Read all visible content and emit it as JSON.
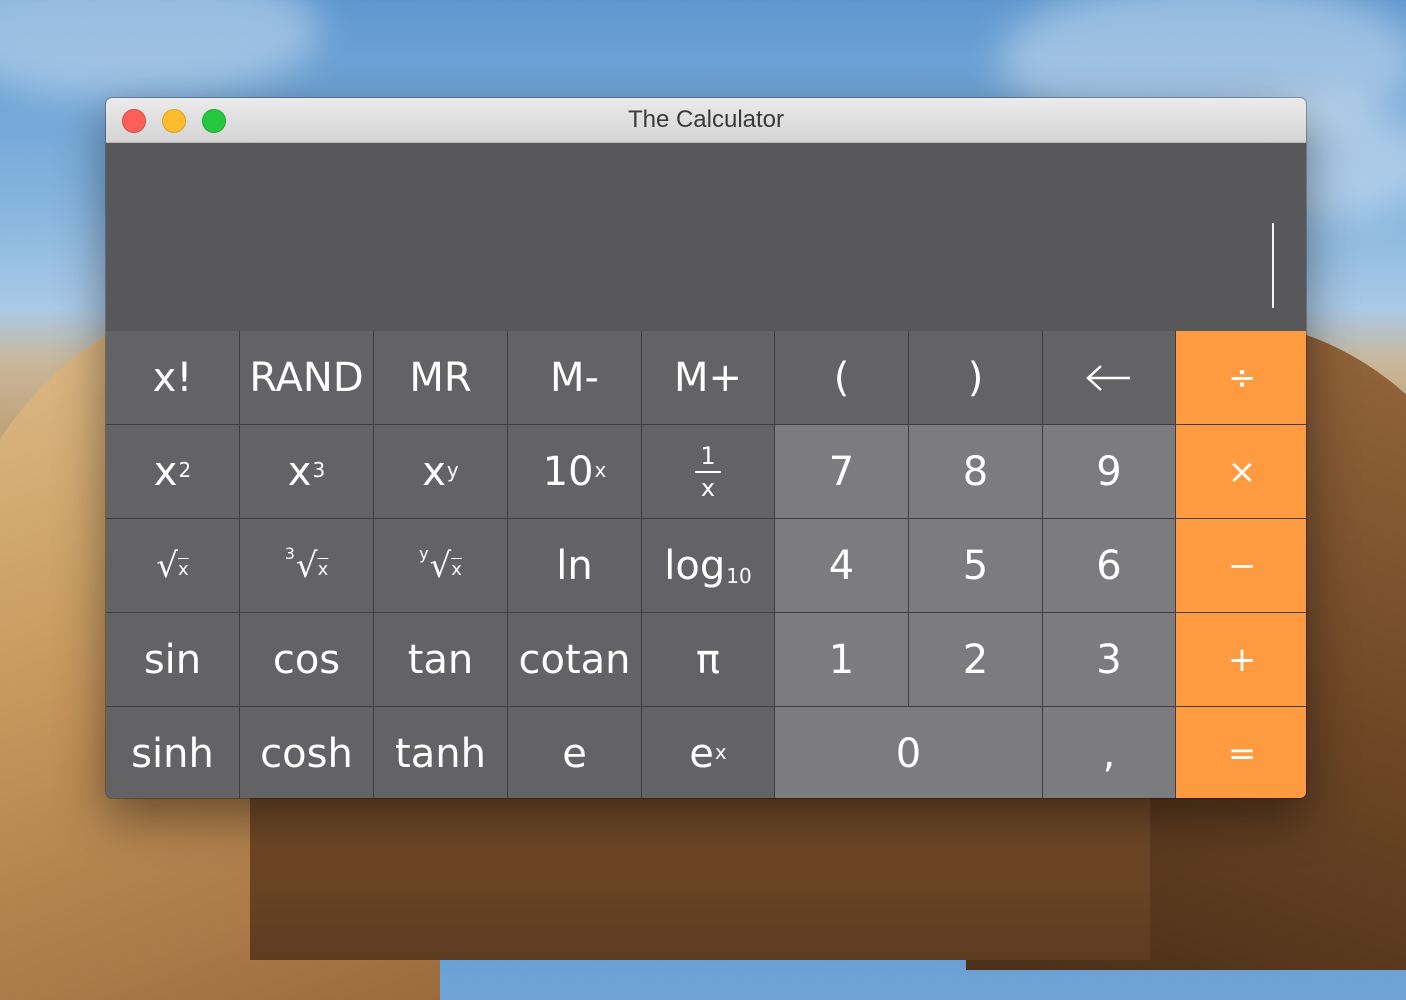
{
  "window": {
    "title": "The Calculator"
  },
  "display": {
    "value": ""
  },
  "keys": {
    "row1": [
      "x!",
      "RAND",
      "MR",
      "M-",
      "M+",
      "(",
      ")",
      "←",
      "÷"
    ],
    "row2": {
      "x2_base": "x",
      "x2_exp": "2",
      "x3_base": "x",
      "x3_exp": "3",
      "xy_base": "x",
      "xy_exp": "y",
      "ten_base": "10",
      "ten_exp": "x",
      "recip_num": "1",
      "recip_den": "x",
      "d7": "7",
      "d8": "8",
      "d9": "9",
      "mul": "×"
    },
    "row3": {
      "sqrt_sym": "√",
      "sqrt_rad": "x",
      "cbrt_idx": "3",
      "cbrt_sym": "√",
      "cbrt_rad": "x",
      "yroot_idx": "y",
      "yroot_sym": "√",
      "yroot_rad": "x",
      "ln": "ln",
      "log_base": "log",
      "log_sub": "10",
      "d4": "4",
      "d5": "5",
      "d6": "6",
      "sub": "−"
    },
    "row4": [
      "sin",
      "cos",
      "tan",
      "cotan",
      "π",
      "1",
      "2",
      "3",
      "+"
    ],
    "row5": {
      "sinh": "sinh",
      "cosh": "cosh",
      "tanh": "tanh",
      "e": "e",
      "ex_base": "e",
      "ex_exp": "x",
      "d0": "0",
      "comma": ",",
      "eq": "="
    }
  },
  "colors": {
    "function_key": "#636365",
    "digit_key": "#7c7c7e",
    "operator_key": "#fe9a3f",
    "display_bg": "#58585a"
  }
}
